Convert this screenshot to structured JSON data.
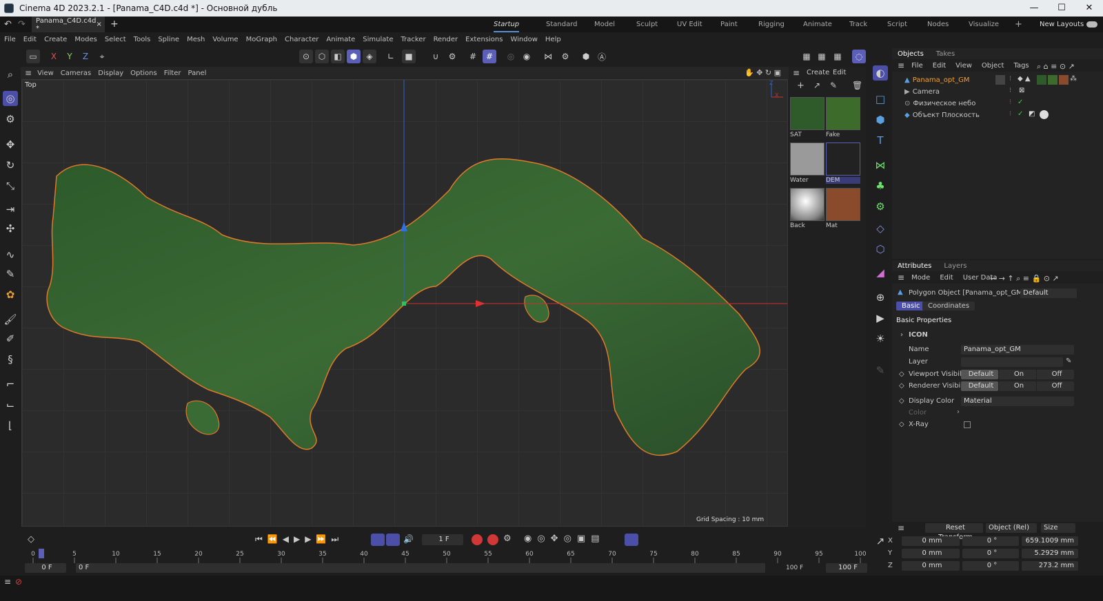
{
  "window": {
    "title": "Cinema 4D 2023.2.1 - [Panama_C4D.c4d *] - Основной дубль",
    "minimize": "—",
    "maximize": "☐",
    "close": "✕"
  },
  "tabs": {
    "doc_tab": "Panama_C4D.c4d *",
    "close": "×",
    "add": "+",
    "layouts": [
      "Startup",
      "Standard",
      "Model",
      "Sculpt",
      "UV Edit",
      "Paint",
      "Rigging",
      "Animate",
      "Track",
      "Script",
      "Nodes",
      "Visualize"
    ],
    "plus": "+",
    "new_layouts": "New Layouts"
  },
  "menu": [
    "File",
    "Edit",
    "Create",
    "Modes",
    "Select",
    "Tools",
    "Spline",
    "Mesh",
    "Volume",
    "MoGraph",
    "Character",
    "Animate",
    "Simulate",
    "Tracker",
    "Render",
    "Extensions",
    "Window",
    "Help"
  ],
  "axes": {
    "x": "X",
    "y": "Y",
    "z": "Z"
  },
  "viewport": {
    "menu": [
      "View",
      "Cameras",
      "Display",
      "Options",
      "Filter",
      "Panel"
    ],
    "name": "Top",
    "grid_spacing": "Grid Spacing : 10 mm",
    "axis_x": "X",
    "axis_z": "Z"
  },
  "materials": {
    "menu": [
      "Create",
      "Edit"
    ],
    "items": [
      {
        "name": "SAT",
        "color": "#2f5a2a"
      },
      {
        "name": "Fake",
        "color": "#3c6b2c"
      },
      {
        "name": "Water",
        "color": "#9a9a9a"
      },
      {
        "name": "DEM",
        "color": "#222222"
      },
      {
        "name": "Back",
        "color": "#e0e0e0"
      },
      {
        "name": "Mat",
        "color": "#8a4a2c"
      }
    ]
  },
  "objects": {
    "tabs": [
      "Objects",
      "Takes"
    ],
    "menu": [
      "File",
      "Edit",
      "View",
      "Object",
      "Tags"
    ],
    "rows": [
      {
        "name": "Panama_opt_GM",
        "selected": true
      },
      {
        "name": "Camera",
        "selected": false
      },
      {
        "name": "Физическое небо",
        "selected": false
      },
      {
        "name": "Объект Плоскость",
        "selected": false
      }
    ]
  },
  "attributes": {
    "tabs": [
      "Attributes",
      "Layers"
    ],
    "menu": [
      "Mode",
      "Edit",
      "User Data"
    ],
    "object_title": "Polygon Object [Panama_opt_GM]",
    "preset": "Default",
    "subtabs": [
      "Basic",
      "Coordinates"
    ],
    "section": "Basic Properties",
    "icon_label": "ICON",
    "name_label": "Name",
    "name_value": "Panama_opt_GM",
    "layer_label": "Layer",
    "viewport_vis": "Viewport Visibility",
    "renderer_vis": "Renderer Visibility",
    "vis_options": [
      "Default",
      "On",
      "Off"
    ],
    "display_color": "Display Color",
    "display_color_value": "Material",
    "color_label": "Color",
    "xray_label": "X-Ray"
  },
  "timeline": {
    "frame": "1 F",
    "ticks": [
      "0",
      "5",
      "10",
      "15",
      "20",
      "25",
      "30",
      "35",
      "40",
      "45",
      "50",
      "55",
      "60",
      "65",
      "70",
      "75",
      "80",
      "85",
      "90",
      "95",
      "100"
    ],
    "start_a": "0 F",
    "start_b": "0 F",
    "end_a": "100 F",
    "end_b": "100 F"
  },
  "transform": {
    "reset": "Reset Transform",
    "mode": "Object (Rel)",
    "size": "Size",
    "rows": [
      {
        "axis": "X",
        "pos": "0 mm",
        "rot": "0 °",
        "size": "659.1009 mm"
      },
      {
        "axis": "Y",
        "pos": "0 mm",
        "rot": "0 °",
        "size": "5.2929 mm"
      },
      {
        "axis": "Z",
        "pos": "0 mm",
        "rot": "0 °",
        "size": "273.2 mm"
      }
    ]
  }
}
